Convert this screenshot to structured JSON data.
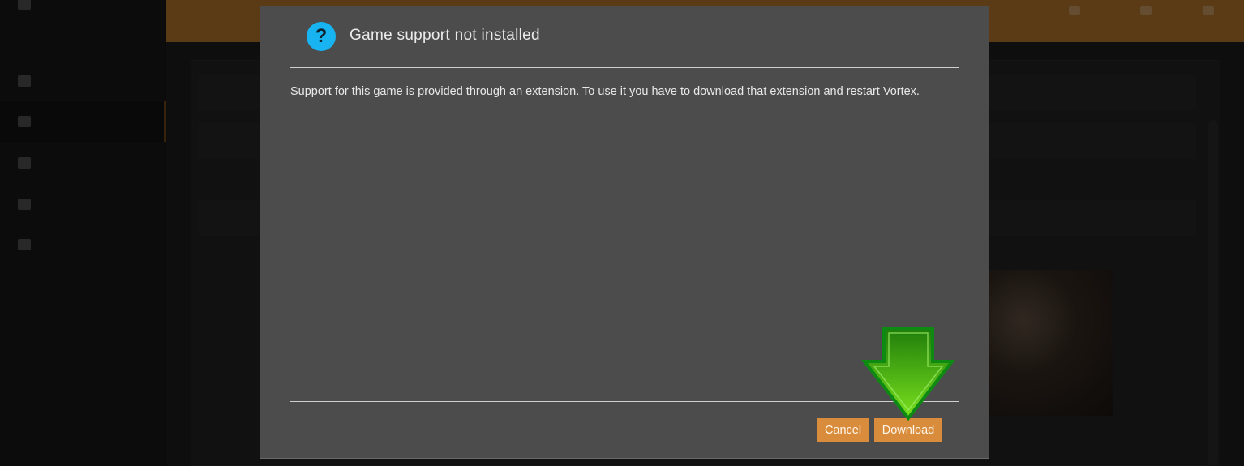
{
  "dialog": {
    "title": "Game support not installed",
    "message": "Support for this game is provided through an extension. To use it you have to download that extension and restart Vortex.",
    "icon": "question-icon",
    "buttons": {
      "cancel": "Cancel",
      "download": "Download"
    },
    "accent_color": "#d98c3c",
    "icon_color": "#18b4f2"
  },
  "annotation": {
    "icon": "arrow-down-icon",
    "color": "#4cbf12"
  },
  "background_app": {
    "topbar_color": "#c9832f"
  }
}
